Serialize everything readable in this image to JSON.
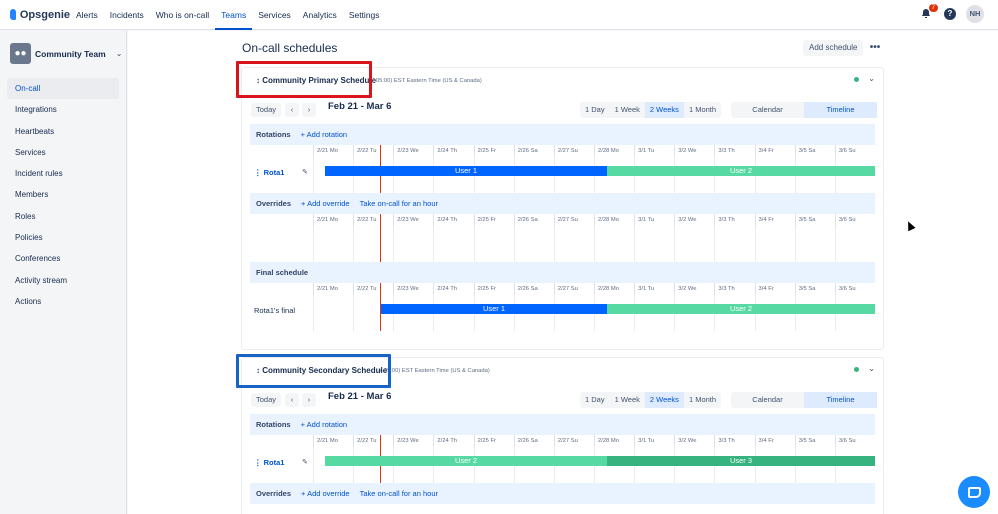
{
  "app": {
    "name": "Opsgenie"
  },
  "nav": {
    "items": [
      "Alerts",
      "Incidents",
      "Who is on-call",
      "Teams",
      "Services",
      "Analytics",
      "Settings"
    ],
    "active": "Teams",
    "notifications_count": "7",
    "help_label": "?",
    "user_initials": "NH"
  },
  "sidebar": {
    "team_name": "Community Team",
    "items": [
      "On-call",
      "Integrations",
      "Heartbeats",
      "Services",
      "Incident rules",
      "Members",
      "Roles",
      "Policies",
      "Conferences",
      "Activity stream",
      "Actions"
    ],
    "active": "On-call"
  },
  "page": {
    "title": "On-call schedules",
    "add_schedule_label": "Add schedule",
    "more_label": "•••"
  },
  "days": [
    "2/21 Mo",
    "2/22 Tu",
    "2/23 We",
    "2/24 Th",
    "2/25 Fr",
    "2/26 Sa",
    "2/27 Su",
    "2/28 Mo",
    "3/1 Tu",
    "3/2 We",
    "3/3 Th",
    "3/4 Fr",
    "3/5 Sa",
    "3/6 Su"
  ],
  "toolbar": {
    "today": "Today",
    "prev": "‹",
    "next": "›",
    "range": "Feb 21 - Mar 6",
    "views": [
      "1 Day",
      "1 Week",
      "2 Weeks",
      "1 Month"
    ],
    "active_view": "2 Weeks",
    "modes": [
      "Calendar",
      "Timeline"
    ],
    "active_mode": "Timeline"
  },
  "labels": {
    "rotations": "Rotations",
    "add_rotation": "+ Add rotation",
    "overrides": "Overrides",
    "add_override": "+ Add override",
    "take_oncall": "Take on-call for an hour",
    "final_schedule": "Final schedule"
  },
  "schedules": [
    {
      "name": "Community Primary Schedule",
      "timezone": "(-05:00) EST Eastern Time (US & Canada)",
      "rotation": "Rota1",
      "final_label": "Rota1's final",
      "rotation_users": [
        "User 1",
        "User 2"
      ],
      "final_users": [
        "User 1",
        "User 2"
      ]
    },
    {
      "name": "Community Secondary Schedule",
      "timezone": "(-05:00) EST Eastern Time (US & Canada)",
      "rotation": "Rota1",
      "rotation_users": [
        "User 2",
        "User 3"
      ]
    }
  ],
  "colors": {
    "accent": "#0052cc",
    "user1": "#0065ff",
    "user2": "#57d9a3",
    "user3": "#36b37e",
    "now_line": "#de350b"
  }
}
